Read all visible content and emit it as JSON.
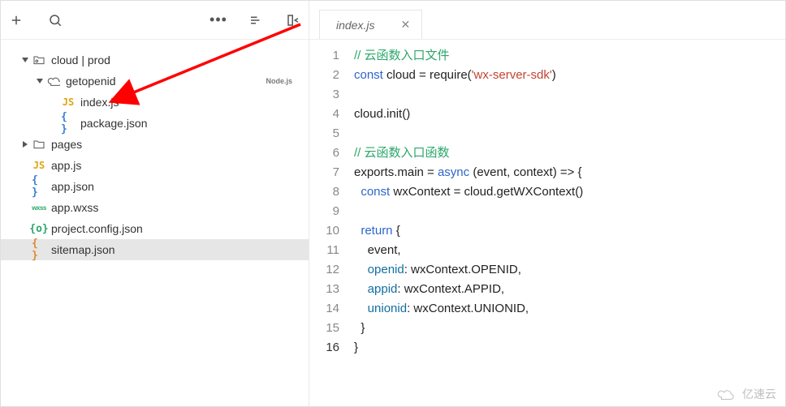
{
  "sidebar": {
    "tree": [
      {
        "indent": 1,
        "arrow": "down",
        "icon": "cloud-folder",
        "label": "cloud | prod",
        "badge": ""
      },
      {
        "indent": 2,
        "arrow": "down",
        "icon": "cloud",
        "label": "getopenid",
        "badge": "Node.js"
      },
      {
        "indent": 3,
        "arrow": "",
        "icon": "js",
        "label": "index.js",
        "badge": ""
      },
      {
        "indent": 3,
        "arrow": "",
        "icon": "json",
        "label": "package.json",
        "badge": ""
      },
      {
        "indent": 1,
        "arrow": "right",
        "icon": "folder",
        "label": "pages",
        "badge": ""
      },
      {
        "indent": 1,
        "arrow": "",
        "icon": "js",
        "label": "app.js",
        "badge": ""
      },
      {
        "indent": 1,
        "arrow": "",
        "icon": "json",
        "label": "app.json",
        "badge": ""
      },
      {
        "indent": 1,
        "arrow": "",
        "icon": "wxss",
        "label": "app.wxss",
        "badge": ""
      },
      {
        "indent": 1,
        "arrow": "",
        "icon": "json-green",
        "label": "project.config.json",
        "badge": ""
      },
      {
        "indent": 1,
        "arrow": "",
        "icon": "json-orange",
        "label": "sitemap.json",
        "badge": "",
        "selected": true
      }
    ]
  },
  "tab": {
    "filename": "index.js"
  },
  "code_lines": [
    [
      {
        "t": "comment",
        "s": "// 云函数入口文件"
      }
    ],
    [
      {
        "t": "keyword",
        "s": "const"
      },
      {
        "t": "default",
        "s": " cloud = require("
      },
      {
        "t": "string",
        "s": "'wx-server-sdk'"
      },
      {
        "t": "default",
        "s": ")"
      }
    ],
    [
      {
        "t": "default",
        "s": ""
      }
    ],
    [
      {
        "t": "default",
        "s": "cloud.init()"
      }
    ],
    [
      {
        "t": "default",
        "s": ""
      }
    ],
    [
      {
        "t": "comment",
        "s": "// 云函数入口函数"
      }
    ],
    [
      {
        "t": "default",
        "s": "exports.main = "
      },
      {
        "t": "keyword",
        "s": "async"
      },
      {
        "t": "default",
        "s": " (event, context) => {"
      }
    ],
    [
      {
        "t": "default",
        "s": "  "
      },
      {
        "t": "keyword",
        "s": "const"
      },
      {
        "t": "default",
        "s": " wxContext = cloud.getWXContext()"
      }
    ],
    [
      {
        "t": "default",
        "s": ""
      }
    ],
    [
      {
        "t": "default",
        "s": "  "
      },
      {
        "t": "keyword",
        "s": "return"
      },
      {
        "t": "default",
        "s": " {"
      }
    ],
    [
      {
        "t": "default",
        "s": "    event,"
      }
    ],
    [
      {
        "t": "default",
        "s": "    "
      },
      {
        "t": "prop",
        "s": "openid"
      },
      {
        "t": "default",
        "s": ": wxContext.OPENID,"
      }
    ],
    [
      {
        "t": "default",
        "s": "    "
      },
      {
        "t": "prop",
        "s": "appid"
      },
      {
        "t": "default",
        "s": ": wxContext.APPID,"
      }
    ],
    [
      {
        "t": "default",
        "s": "    "
      },
      {
        "t": "prop",
        "s": "unionid"
      },
      {
        "t": "default",
        "s": ": wxContext.UNIONID,"
      }
    ],
    [
      {
        "t": "default",
        "s": "  }"
      }
    ],
    [
      {
        "t": "default",
        "s": "}"
      }
    ]
  ],
  "watermark": "亿速云"
}
